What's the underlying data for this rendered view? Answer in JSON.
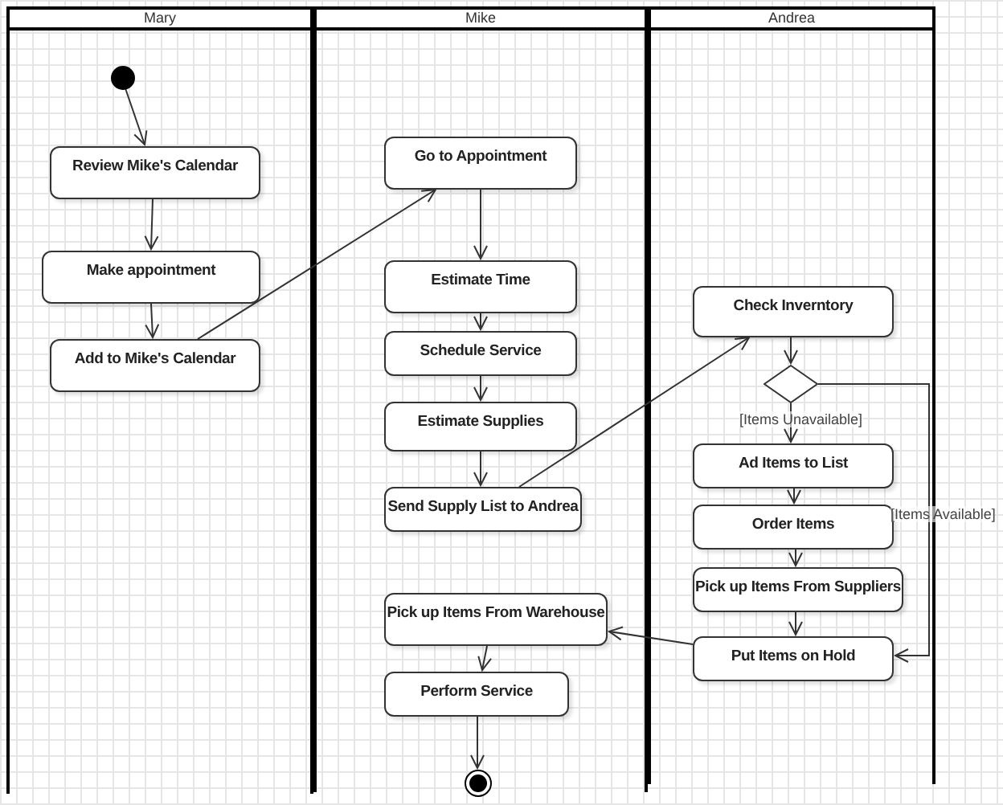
{
  "lanes": [
    {
      "title": "Mary",
      "nodes": [
        {
          "kind": "initial"
        },
        {
          "kind": "action",
          "label": "Review Mike's Calendar"
        },
        {
          "kind": "action",
          "label": "Make appointment"
        },
        {
          "kind": "action",
          "label": "Add to Mike's Calendar"
        }
      ]
    },
    {
      "title": "Mike",
      "nodes": [
        {
          "kind": "action",
          "label": "Go to Appointment"
        },
        {
          "kind": "action",
          "label": "Estimate Time"
        },
        {
          "kind": "action",
          "label": "Schedule Service"
        },
        {
          "kind": "action",
          "label": "Estimate Supplies"
        },
        {
          "kind": "action",
          "label": "Send Supply List to Andrea"
        },
        {
          "kind": "action",
          "label": "Pick up Items From Warehouse"
        },
        {
          "kind": "action",
          "label": "Perform Service"
        },
        {
          "kind": "final"
        }
      ]
    },
    {
      "title": "Andrea",
      "nodes": [
        {
          "kind": "action",
          "label": "Check Inverntory"
        },
        {
          "kind": "decision"
        },
        {
          "kind": "guard",
          "label": "[Items Unavailable]"
        },
        {
          "kind": "action",
          "label": "Ad Items to List"
        },
        {
          "kind": "action",
          "label": "Order Items"
        },
        {
          "kind": "guard",
          "label": "[Items Available]"
        },
        {
          "kind": "action",
          "label": "Pick up Items From Suppliers"
        },
        {
          "kind": "action",
          "label": "Put Items on Hold"
        }
      ]
    }
  ]
}
